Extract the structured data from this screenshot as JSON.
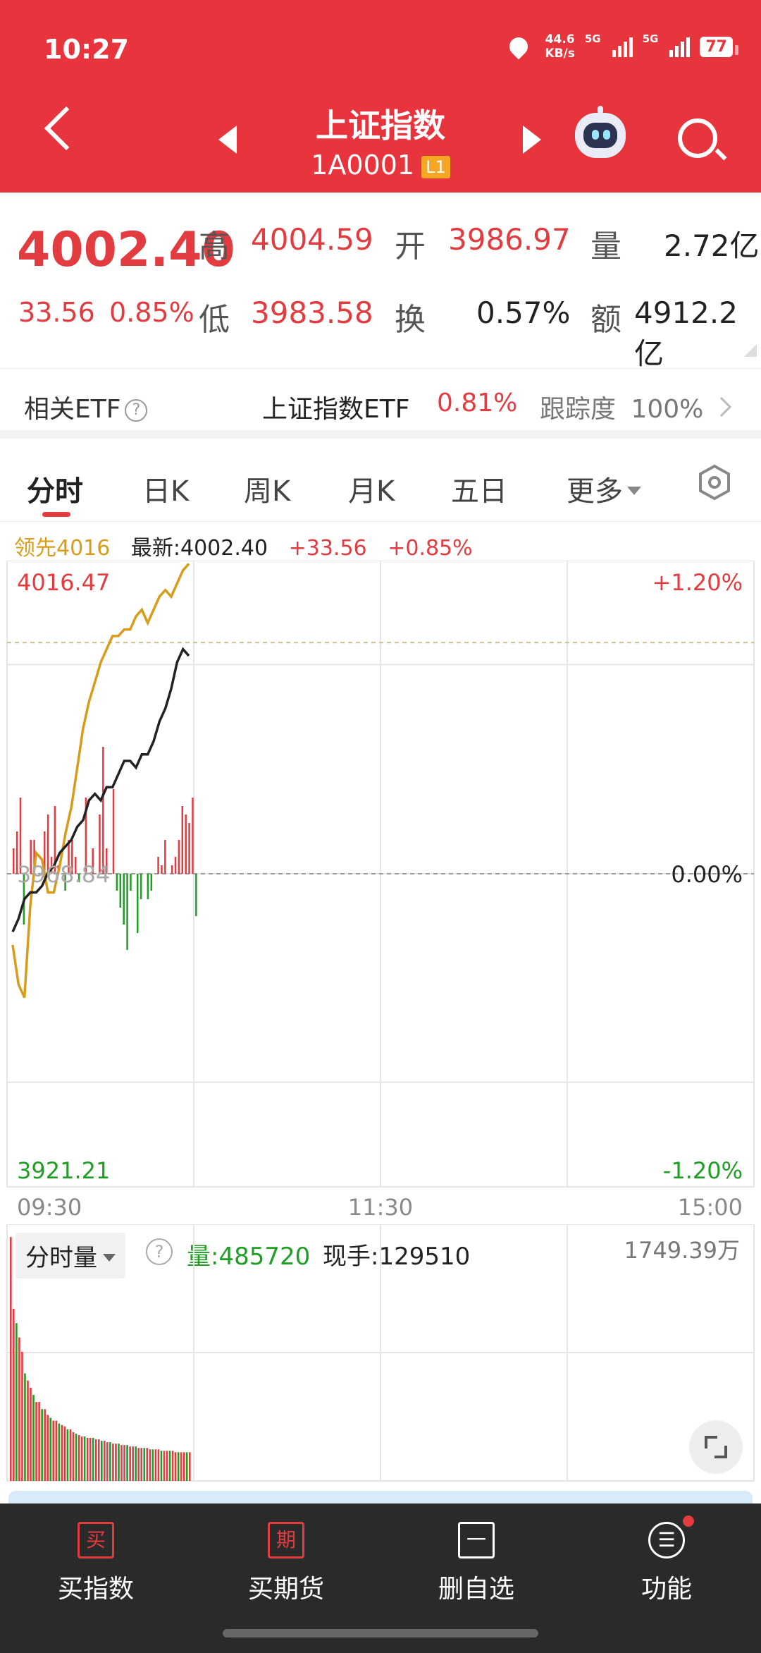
{
  "status": {
    "time": "10:27",
    "net_speed": "44.6",
    "net_unit": "KB/s",
    "sim1": "5G",
    "sim2": "5G",
    "battery": "77"
  },
  "header": {
    "title": "上证指数",
    "code": "1A0001",
    "badge": "L1",
    "background": "#e8343d"
  },
  "quote": {
    "price": "4002.40",
    "change": "33.56",
    "change_pct": "0.85%",
    "high_label": "高",
    "high": "4004.59",
    "open_label": "开",
    "open": "3986.97",
    "volume_label": "量",
    "volume": "2.72亿",
    "low_label": "低",
    "low": "3983.58",
    "turnover_label": "换",
    "turnover": "0.57%",
    "amount_label": "额",
    "amount": "4912.2亿"
  },
  "etf": {
    "label": "相关ETF",
    "info": "?",
    "name": "上证指数ETF",
    "pct": "0.81%",
    "track_label": "跟踪度",
    "track_value": "100%"
  },
  "tabs": [
    "分时",
    "日K",
    "周K",
    "月K",
    "五日",
    "更多"
  ],
  "legend": {
    "lead": "领先4016",
    "latest": "最新:4002.40",
    "change": "+33.56",
    "pct": "+0.85%"
  },
  "chart_data": {
    "type": "line",
    "y_labels": {
      "top": "4016.47",
      "mid": "3968.84",
      "bottom": "3921.21"
    },
    "pct_labels": {
      "top": "+1.20%",
      "mid": "0.00%",
      "bottom": "-1.20%"
    },
    "x_labels": [
      "09:30",
      "11:30",
      "15:00"
    ],
    "ylim": [
      3921.21,
      4016.47
    ],
    "prev_close": 3968.84,
    "series": [
      {
        "name": "领先",
        "color": "#d89b1a",
        "values": [
          3958,
          3952,
          3950,
          3964,
          3972,
          3971,
          3966,
          3966,
          3970,
          3975,
          3979,
          3985,
          3991,
          3995,
          3998,
          4001,
          4003,
          4005,
          4005,
          4006,
          4006,
          4008,
          4009,
          4007,
          4009,
          4011,
          4012,
          4011,
          4013,
          4015,
          4016
        ]
      },
      {
        "name": "最新",
        "color": "#222222",
        "values": [
          3960,
          3962,
          3965,
          3966,
          3966,
          3967,
          3969,
          3970,
          3972,
          3973,
          3974,
          3976,
          3977,
          3980,
          3981,
          3980,
          3982,
          3982,
          3984,
          3986,
          3986,
          3985,
          3987,
          3987,
          3989,
          3992,
          3994,
          3997,
          4001,
          4003,
          4002
        ]
      }
    ],
    "bars": [
      3,
      5,
      9,
      -6,
      0,
      4,
      4,
      0,
      0,
      5,
      7,
      2,
      8,
      1,
      0,
      -2,
      4,
      4,
      2,
      -1,
      0,
      9,
      0,
      3,
      0,
      7,
      15,
      3,
      0,
      10,
      -2,
      -4,
      -6,
      -9,
      -2,
      0,
      -7,
      -3,
      0,
      -3,
      -2,
      0,
      2,
      1,
      4,
      0,
      1,
      2,
      4,
      8,
      7,
      6,
      9,
      -5
    ],
    "volume": {
      "label": "分时量",
      "help": "?",
      "amount": "量:485720",
      "now_hand": "现手:129510",
      "max": "1749.39万",
      "values": [
        17,
        12,
        11,
        10,
        9,
        7.5,
        7,
        6.5,
        6,
        5.5,
        5.5,
        5,
        5,
        4.6,
        4.4,
        4.2,
        4.2,
        4,
        3.9,
        3.8,
        3.6,
        3.6,
        3.4,
        3.3,
        3.2,
        3.1,
        3.1,
        3,
        3,
        3,
        2.9,
        2.9,
        2.8,
        2.8,
        2.7,
        2.7,
        2.6,
        2.6,
        2.6,
        2.5,
        2.5,
        2.5,
        2.4,
        2.4,
        2.4,
        2.3,
        2.3,
        2.3,
        2.3,
        2.2,
        2.2,
        2.2,
        2.2,
        2.1,
        2.1,
        2.1,
        2.1,
        2.1,
        2,
        2,
        2,
        2,
        2,
        2
      ],
      "colors": [
        "#e23b40",
        "#1f9e24"
      ]
    }
  },
  "bottom_nav": [
    {
      "icon": "买",
      "label": "买指数"
    },
    {
      "icon": "期",
      "label": "买期货"
    },
    {
      "icon": "一",
      "label": "删自选"
    },
    {
      "icon": "☰",
      "label": "功能"
    }
  ],
  "colors": {
    "up": "#e23b40",
    "down": "#1f9e24",
    "lead": "#d89b1a"
  }
}
